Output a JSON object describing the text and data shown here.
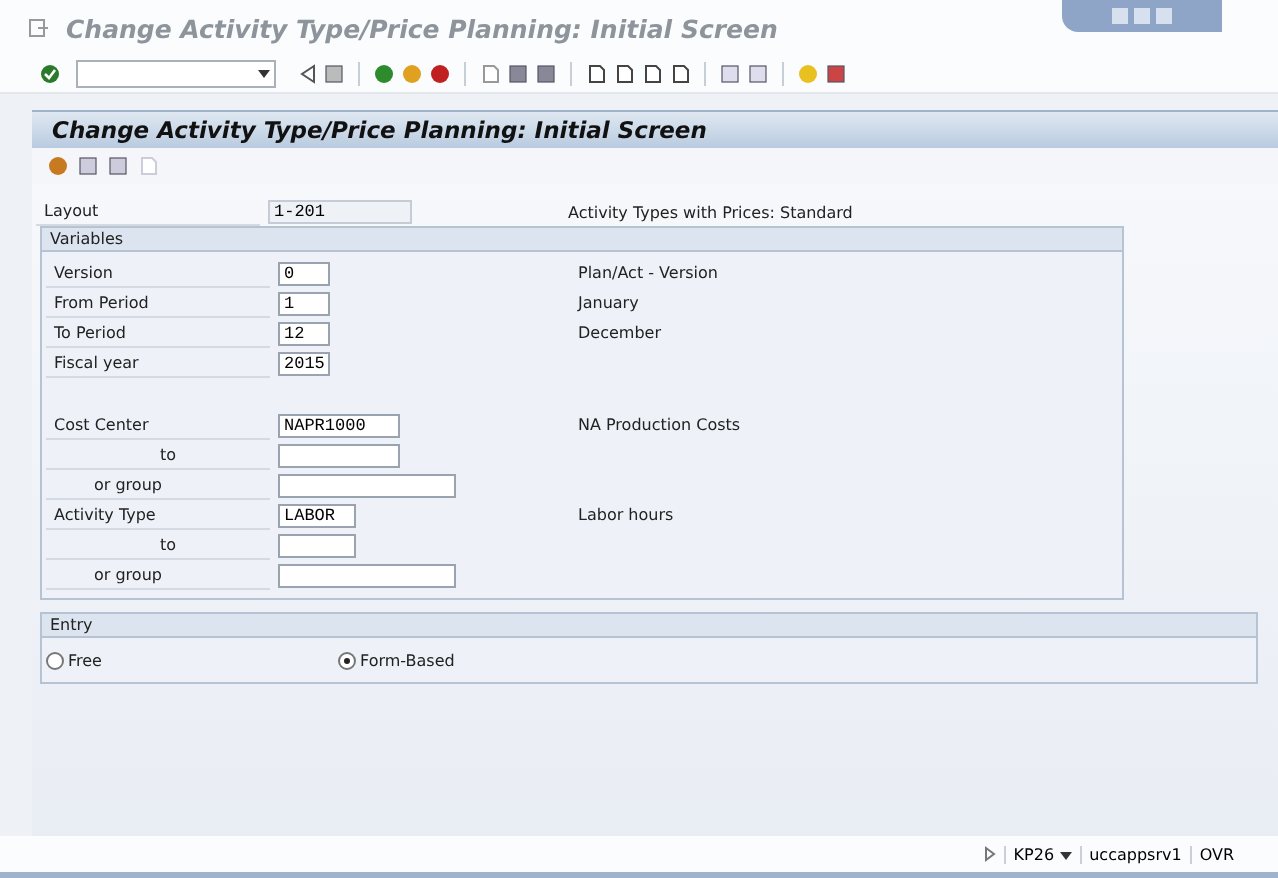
{
  "window": {
    "title": "Change Activity Type/Price Planning: Initial Screen"
  },
  "header": {
    "title": "Change Activity Type/Price Planning: Initial Screen"
  },
  "layout": {
    "label": "Layout",
    "value": "1-201",
    "description": "Activity Types with Prices: Standard"
  },
  "variables": {
    "title": "Variables",
    "period_rows": [
      {
        "label": "Version",
        "value": "0",
        "description": "Plan/Act - Version"
      },
      {
        "label": "From Period",
        "value": "1",
        "description": "January"
      },
      {
        "label": "To Period",
        "value": "12",
        "description": "December"
      },
      {
        "label": "Fiscal year",
        "value": "2015"
      }
    ],
    "object_rows": [
      {
        "kind": "main",
        "label": "Cost Center",
        "value": "NAPR1000",
        "description": "NA Production Costs"
      },
      {
        "kind": "range",
        "label": "to"
      },
      {
        "kind": "group",
        "label": "or group"
      },
      {
        "kind": "main",
        "label": "Activity Type",
        "value": "LABOR",
        "description": "Labor hours"
      },
      {
        "kind": "range",
        "label": "to"
      },
      {
        "kind": "group",
        "label": "or group"
      }
    ]
  },
  "entry": {
    "title": "Entry",
    "options": [
      {
        "label": "Free",
        "selected": false
      },
      {
        "label": "Form-Based",
        "selected": true
      }
    ]
  },
  "status_bar": {
    "transaction": "KP26",
    "server": "uccappsrv1",
    "mode": "OVR"
  }
}
